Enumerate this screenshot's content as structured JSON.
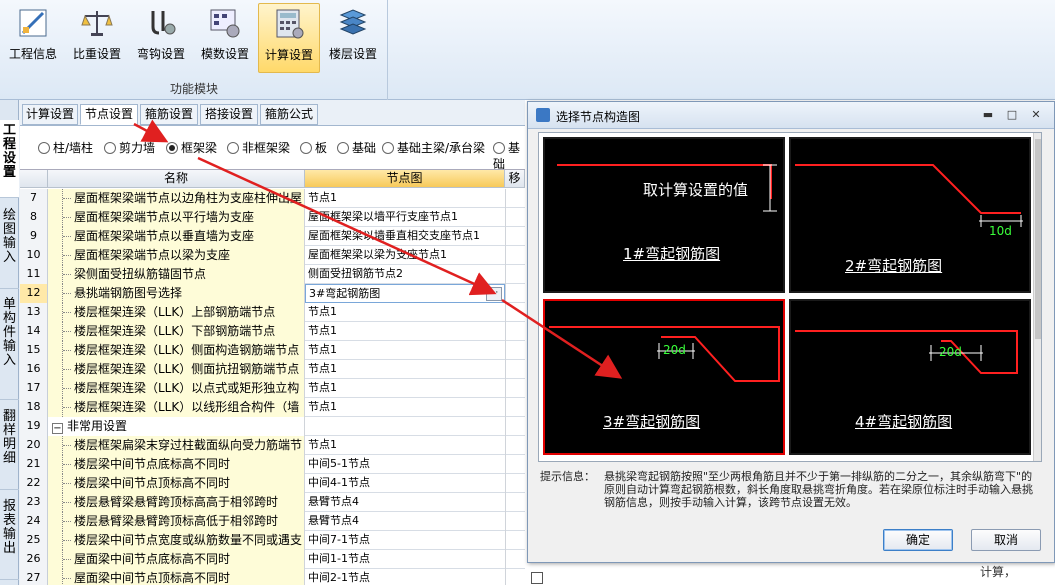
{
  "ribbon": {
    "buttons": [
      {
        "label": "工程信息",
        "icon": "project-info-icon",
        "active": false
      },
      {
        "label": "比重设置",
        "icon": "scale-icon",
        "active": false
      },
      {
        "label": "弯钩设置",
        "icon": "hook-icon",
        "active": false
      },
      {
        "label": "模数设置",
        "icon": "modulus-icon",
        "active": false
      },
      {
        "label": "计算设置",
        "icon": "calculator-icon",
        "active": true
      },
      {
        "label": "楼层设置",
        "icon": "floor-stack-icon",
        "active": false
      }
    ],
    "group_label": "功能模块"
  },
  "sidebar": {
    "tabs": [
      {
        "label": "工程设置",
        "selected": true
      },
      {
        "label": "绘图输入",
        "selected": false
      },
      {
        "label": "单构件输入",
        "selected": false
      },
      {
        "label": "翻样明细",
        "selected": false
      },
      {
        "label": "报表输出",
        "selected": false
      }
    ]
  },
  "tabs": [
    "计算设置",
    "节点设置",
    "箍筋设置",
    "搭接设置",
    "箍筋公式"
  ],
  "selected_tab": "节点设置",
  "component_types": {
    "options": [
      "柱/墙柱",
      "剪力墙",
      "框架梁",
      "非框架梁",
      "板",
      "基础",
      "基础主梁/承台梁",
      "基础"
    ],
    "selected": "框架梁"
  },
  "grid": {
    "columns": [
      "名称",
      "节点图",
      "移"
    ],
    "rows": [
      {
        "no": "7",
        "name": "屋面框架梁端节点以边角柱为支座柱伸出屋",
        "value": "节点1",
        "group": false
      },
      {
        "no": "8",
        "name": "屋面框架梁端节点以平行墙为支座",
        "value": "屋面框架梁以墙平行支座节点1",
        "group": false
      },
      {
        "no": "9",
        "name": "屋面框架梁端节点以垂直墙为支座",
        "value": "屋面框架梁以墙垂直相交支座节点1",
        "group": false
      },
      {
        "no": "10",
        "name": "屋面框架梁端节点以梁为支座",
        "value": "屋面框架梁以梁为支座节点1",
        "group": false
      },
      {
        "no": "11",
        "name": "梁侧面受扭纵筋锚固节点",
        "value": "侧面受扭钢筋节点2",
        "group": false
      },
      {
        "no": "12",
        "name": "悬挑端钢筋图号选择",
        "value": "3#弯起钢筋图",
        "group": false,
        "current": true
      },
      {
        "no": "13",
        "name": "楼层框架连梁（LLK）上部钢筋端节点",
        "value": "节点1",
        "group": false
      },
      {
        "no": "14",
        "name": "楼层框架连梁（LLK）下部钢筋端节点",
        "value": "节点1",
        "group": false
      },
      {
        "no": "15",
        "name": "楼层框架连梁（LLK）侧面构造钢筋端节点",
        "value": "节点1",
        "group": false
      },
      {
        "no": "16",
        "name": "楼层框架连梁（LLK）侧面抗扭钢筋端节点",
        "value": "节点1",
        "group": false
      },
      {
        "no": "17",
        "name": "楼层框架连梁（LLK）以点式或矩形独立构",
        "value": "节点1",
        "group": false
      },
      {
        "no": "18",
        "name": "楼层框架连梁（LLK）以线形组合构件（墙",
        "value": "节点1",
        "group": false
      },
      {
        "no": "19",
        "name": "非常用设置",
        "value": "",
        "group": true
      },
      {
        "no": "20",
        "name": "楼层框架扁梁末穿过柱截面纵向受力筋端节",
        "value": "节点1",
        "group": false
      },
      {
        "no": "21",
        "name": "楼层梁中间节点底标高不同时",
        "value": "中间5-1节点",
        "group": false
      },
      {
        "no": "22",
        "name": "楼层梁中间节点顶标高不同时",
        "value": "中间4-1节点",
        "group": false
      },
      {
        "no": "23",
        "name": "楼层悬臂梁悬臂跨顶标高高于相邻跨时",
        "value": "悬臂节点4",
        "group": false
      },
      {
        "no": "24",
        "name": "楼层悬臂梁悬臂跨顶标高低于相邻跨时",
        "value": "悬臂节点4",
        "group": false
      },
      {
        "no": "25",
        "name": "楼层梁中间节点宽度或纵筋数量不同或遇支",
        "value": "中间7-1节点",
        "group": false
      },
      {
        "no": "26",
        "name": "屋面梁中间节点底标高不同时",
        "value": "中间1-1节点",
        "group": false
      },
      {
        "no": "27",
        "name": "屋面梁中间节点顶标高不同时",
        "value": "中间2-1节点",
        "group": false
      }
    ]
  },
  "dialog": {
    "title": "选择节点构造图",
    "tiles": [
      {
        "label": "1#弯起钢筋图",
        "annotation": "取计算设置的值",
        "selected": false
      },
      {
        "label": "2#弯起钢筋图",
        "annotation": "10d",
        "selected": false
      },
      {
        "label": "3#弯起钢筋图",
        "annotation": "20d",
        "selected": true
      },
      {
        "label": "4#弯起钢筋图",
        "annotation": "20d",
        "selected": false
      }
    ],
    "hint_label": "提示信息：",
    "hint_text": "悬挑梁弯起钢筋按照\"至少两根角筋且并不少于第一排纵筋的二分之一，其余纵筋弯下\"的原则自动计算弯起钢筋根数，斜长角度取悬挑弯折角度。若在梁原位标注时手动输入悬挑钢筋信息，则按手动输入计算，该跨节点设置无效。",
    "ok_label": "确定",
    "cancel_label": "取消"
  },
  "status_text": "计算，"
}
